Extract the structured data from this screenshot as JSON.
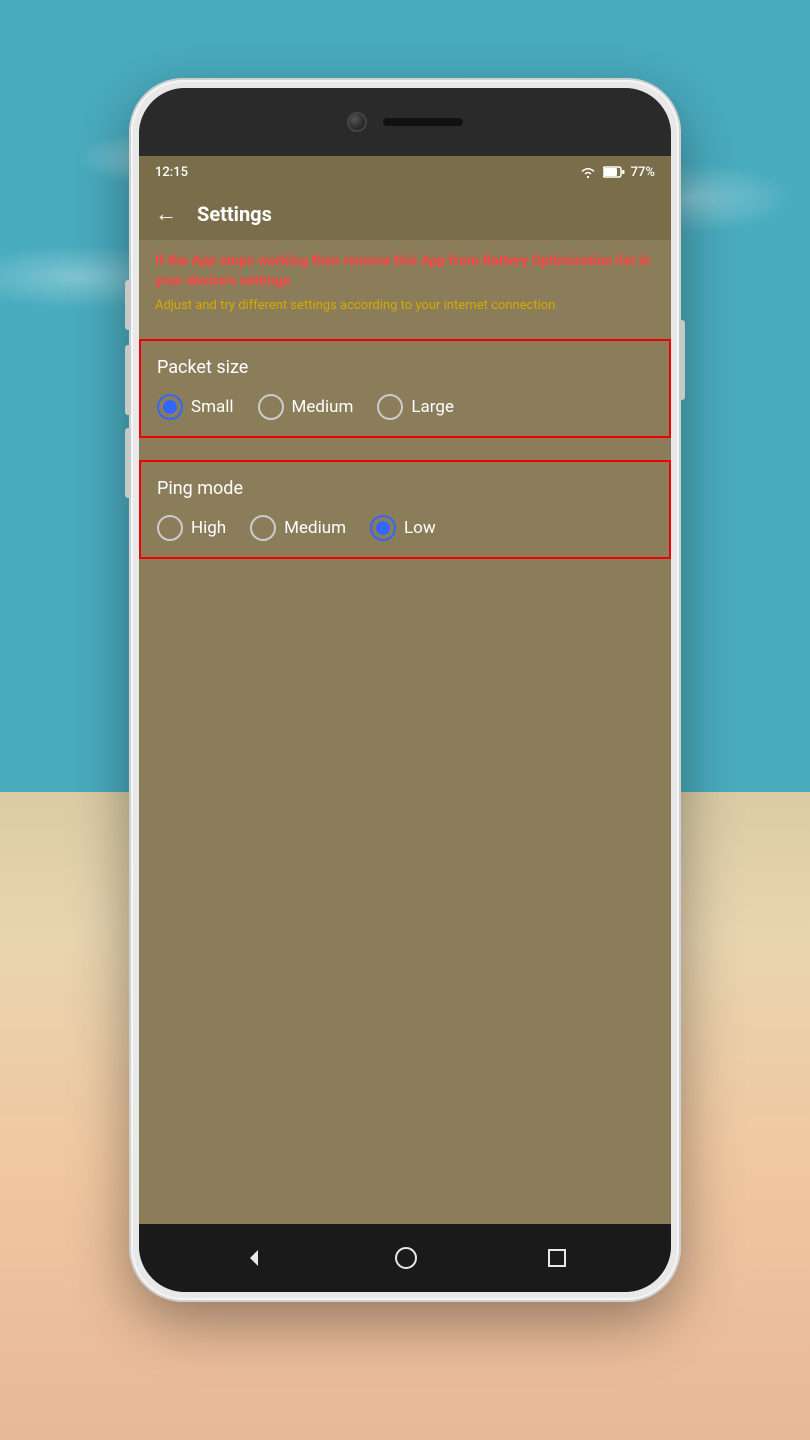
{
  "background": {
    "description": "Beach and ocean background"
  },
  "status_bar": {
    "time": "12:15",
    "wifi_icon": "wifi",
    "battery_icon": "battery",
    "battery_percent": "77%"
  },
  "app_bar": {
    "back_label": "←",
    "title": "Settings"
  },
  "warnings": {
    "red_text": "If the App stops working then remove this App from Battery Optimization list in your device's settings",
    "yellow_text": "Adjust and try different settings according to your internet connection"
  },
  "packet_size_section": {
    "title": "Packet size",
    "options": [
      {
        "label": "Small",
        "selected": true
      },
      {
        "label": "Medium",
        "selected": false
      },
      {
        "label": "Large",
        "selected": false
      }
    ]
  },
  "ping_mode_section": {
    "title": "Ping mode",
    "options": [
      {
        "label": "High",
        "selected": false
      },
      {
        "label": "Medium",
        "selected": false
      },
      {
        "label": "Low",
        "selected": true
      }
    ]
  },
  "nav_bar": {
    "back_btn": "◀",
    "home_btn": "⬤",
    "recent_btn": "■"
  }
}
